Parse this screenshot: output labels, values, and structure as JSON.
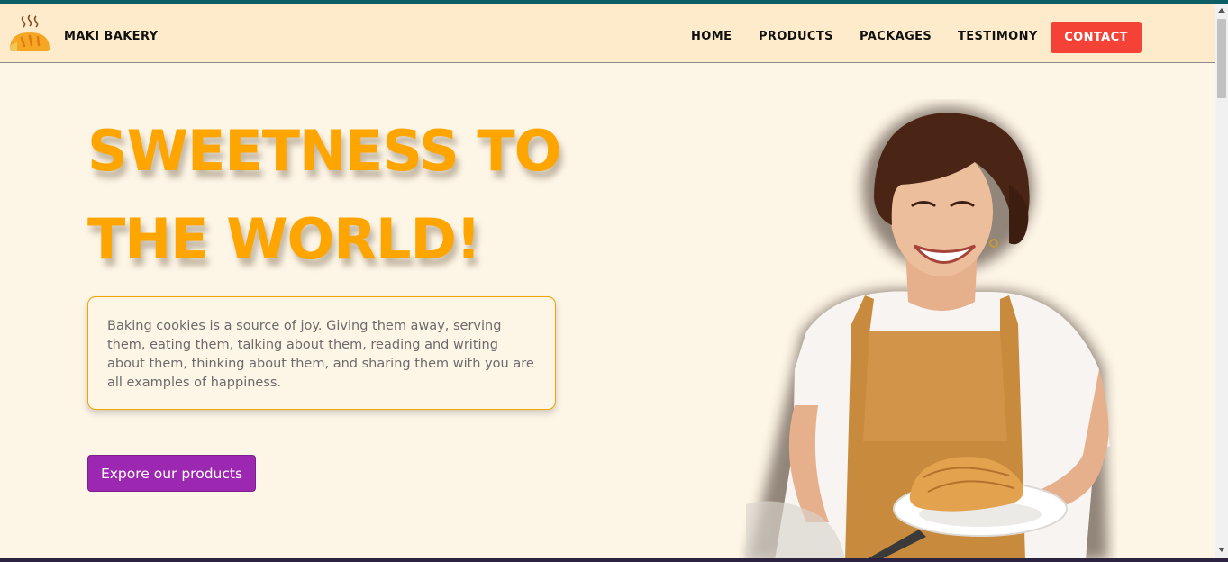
{
  "header": {
    "brand_name": "MAKI BAKERY",
    "logo_icon": "bread-steam-icon",
    "nav": {
      "home": "HOME",
      "products": "PRODUCTS",
      "packages": "PACKAGES",
      "testimony": "TESTIMONY",
      "contact": "CONTACT"
    }
  },
  "hero": {
    "title_line1": "SWEETNESS TO",
    "title_line2": "THE WORLD!",
    "description": "Baking cookies is a source of joy. Giving them away, serving them, eating them, talking about them, reading and writing about them, thinking about them, and sharing them with you are all examples of happiness.",
    "cta_label": "Expore our products",
    "image_subject": "smiling-baker-holding-pastry"
  },
  "colors": {
    "accent_orange": "#ffa500",
    "contact_red": "#f44336",
    "cta_purple": "#9c27b0",
    "navbar_bg": "#fdebcb",
    "page_bg": "#fdf5e6"
  }
}
